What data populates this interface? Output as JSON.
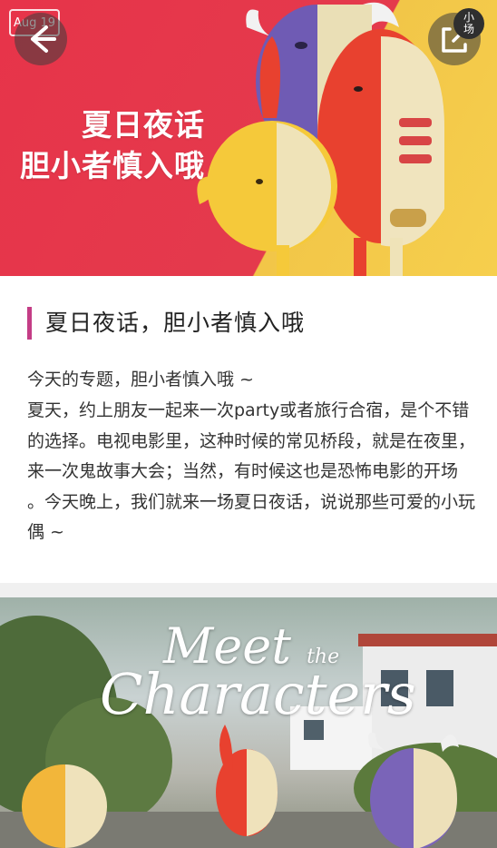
{
  "hero": {
    "line1": "夏日夜话",
    "line2": "胆小者慎入哦",
    "date_stamp": "Aug 19",
    "mini_badge": "小\n场"
  },
  "article": {
    "title": "夏日夜话，胆小者慎入哦",
    "paragraph1": "今天的专题，胆小者慎入哦 ~",
    "paragraph2": "夏天，约上朋友一起来一次party或者旅行合宿，是个不错的选择。电视电影里，这种时候的常见桥段，就是在夜里，来一次鬼故事大会；当然，有时候这也是恐怖电影的开场 。今天晚上，我们就来一场夏日夜话，说说那些可爱的小玩偶 ~"
  },
  "photo": {
    "script_line1": "Meet",
    "script_line1_small": "the",
    "script_line2": "Characters"
  },
  "icons": {
    "back": "arrow-left-icon",
    "share": "share-icon"
  }
}
